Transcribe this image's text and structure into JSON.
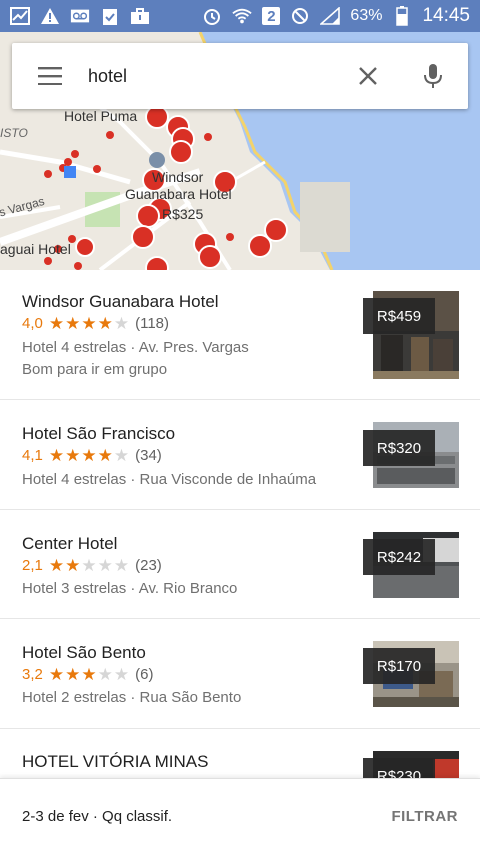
{
  "status_bar": {
    "left_icons": [
      "chart-icon",
      "warning-icon",
      "voicemail-icon",
      "clipboard-check-icon",
      "briefcase-icon"
    ],
    "right_icons": [
      "alarm-icon",
      "wifi-icon",
      "sim2-icon",
      "blocked-icon",
      "signal-icon"
    ],
    "sim_label": "2",
    "battery": "63%",
    "time": "14:45"
  },
  "search": {
    "query": "hotel"
  },
  "map": {
    "labels": [
      "Hotel Puma",
      "Windsor",
      "Guanabara Hotel",
      "R$325",
      "Vargas",
      "aguai Hotel",
      "ISTO"
    ]
  },
  "results": [
    {
      "name": "Windsor Guanabara Hotel",
      "rating": "4,0",
      "stars": 4,
      "reviews": "(118)",
      "meta": "Hotel 4 estrelas · Av. Pres. Vargas",
      "extra": "Bom para ir em grupo",
      "price": "R$459"
    },
    {
      "name": "Hotel São Francisco",
      "rating": "4,1",
      "stars": 4,
      "reviews": "(34)",
      "meta": "Hotel 4 estrelas · Rua Visconde de Inhaúma",
      "extra": "",
      "price": "R$320"
    },
    {
      "name": "Center Hotel",
      "rating": "2,1",
      "stars": 2,
      "reviews": "(23)",
      "meta": "Hotel 3 estrelas · Av. Rio Branco",
      "extra": "",
      "price": "R$242"
    },
    {
      "name": "Hotel São Bento",
      "rating": "3,2",
      "stars": 3,
      "reviews": "(6)",
      "meta": "Hotel 2 estrelas · Rua São Bento",
      "extra": "",
      "price": "R$170"
    },
    {
      "name": "HOTEL VITÓRIA MINAS",
      "rating": "",
      "stars": 0,
      "reviews": "",
      "meta": "",
      "extra": "",
      "price": "R$230"
    }
  ],
  "bottom_bar": {
    "dates_filter": "2-3 de fev · Qq classif.",
    "filter_label": "FILTRAR"
  },
  "colors": {
    "status_bar": "#5d7fbd",
    "star": "#e8790c",
    "marker": "#d93025"
  }
}
